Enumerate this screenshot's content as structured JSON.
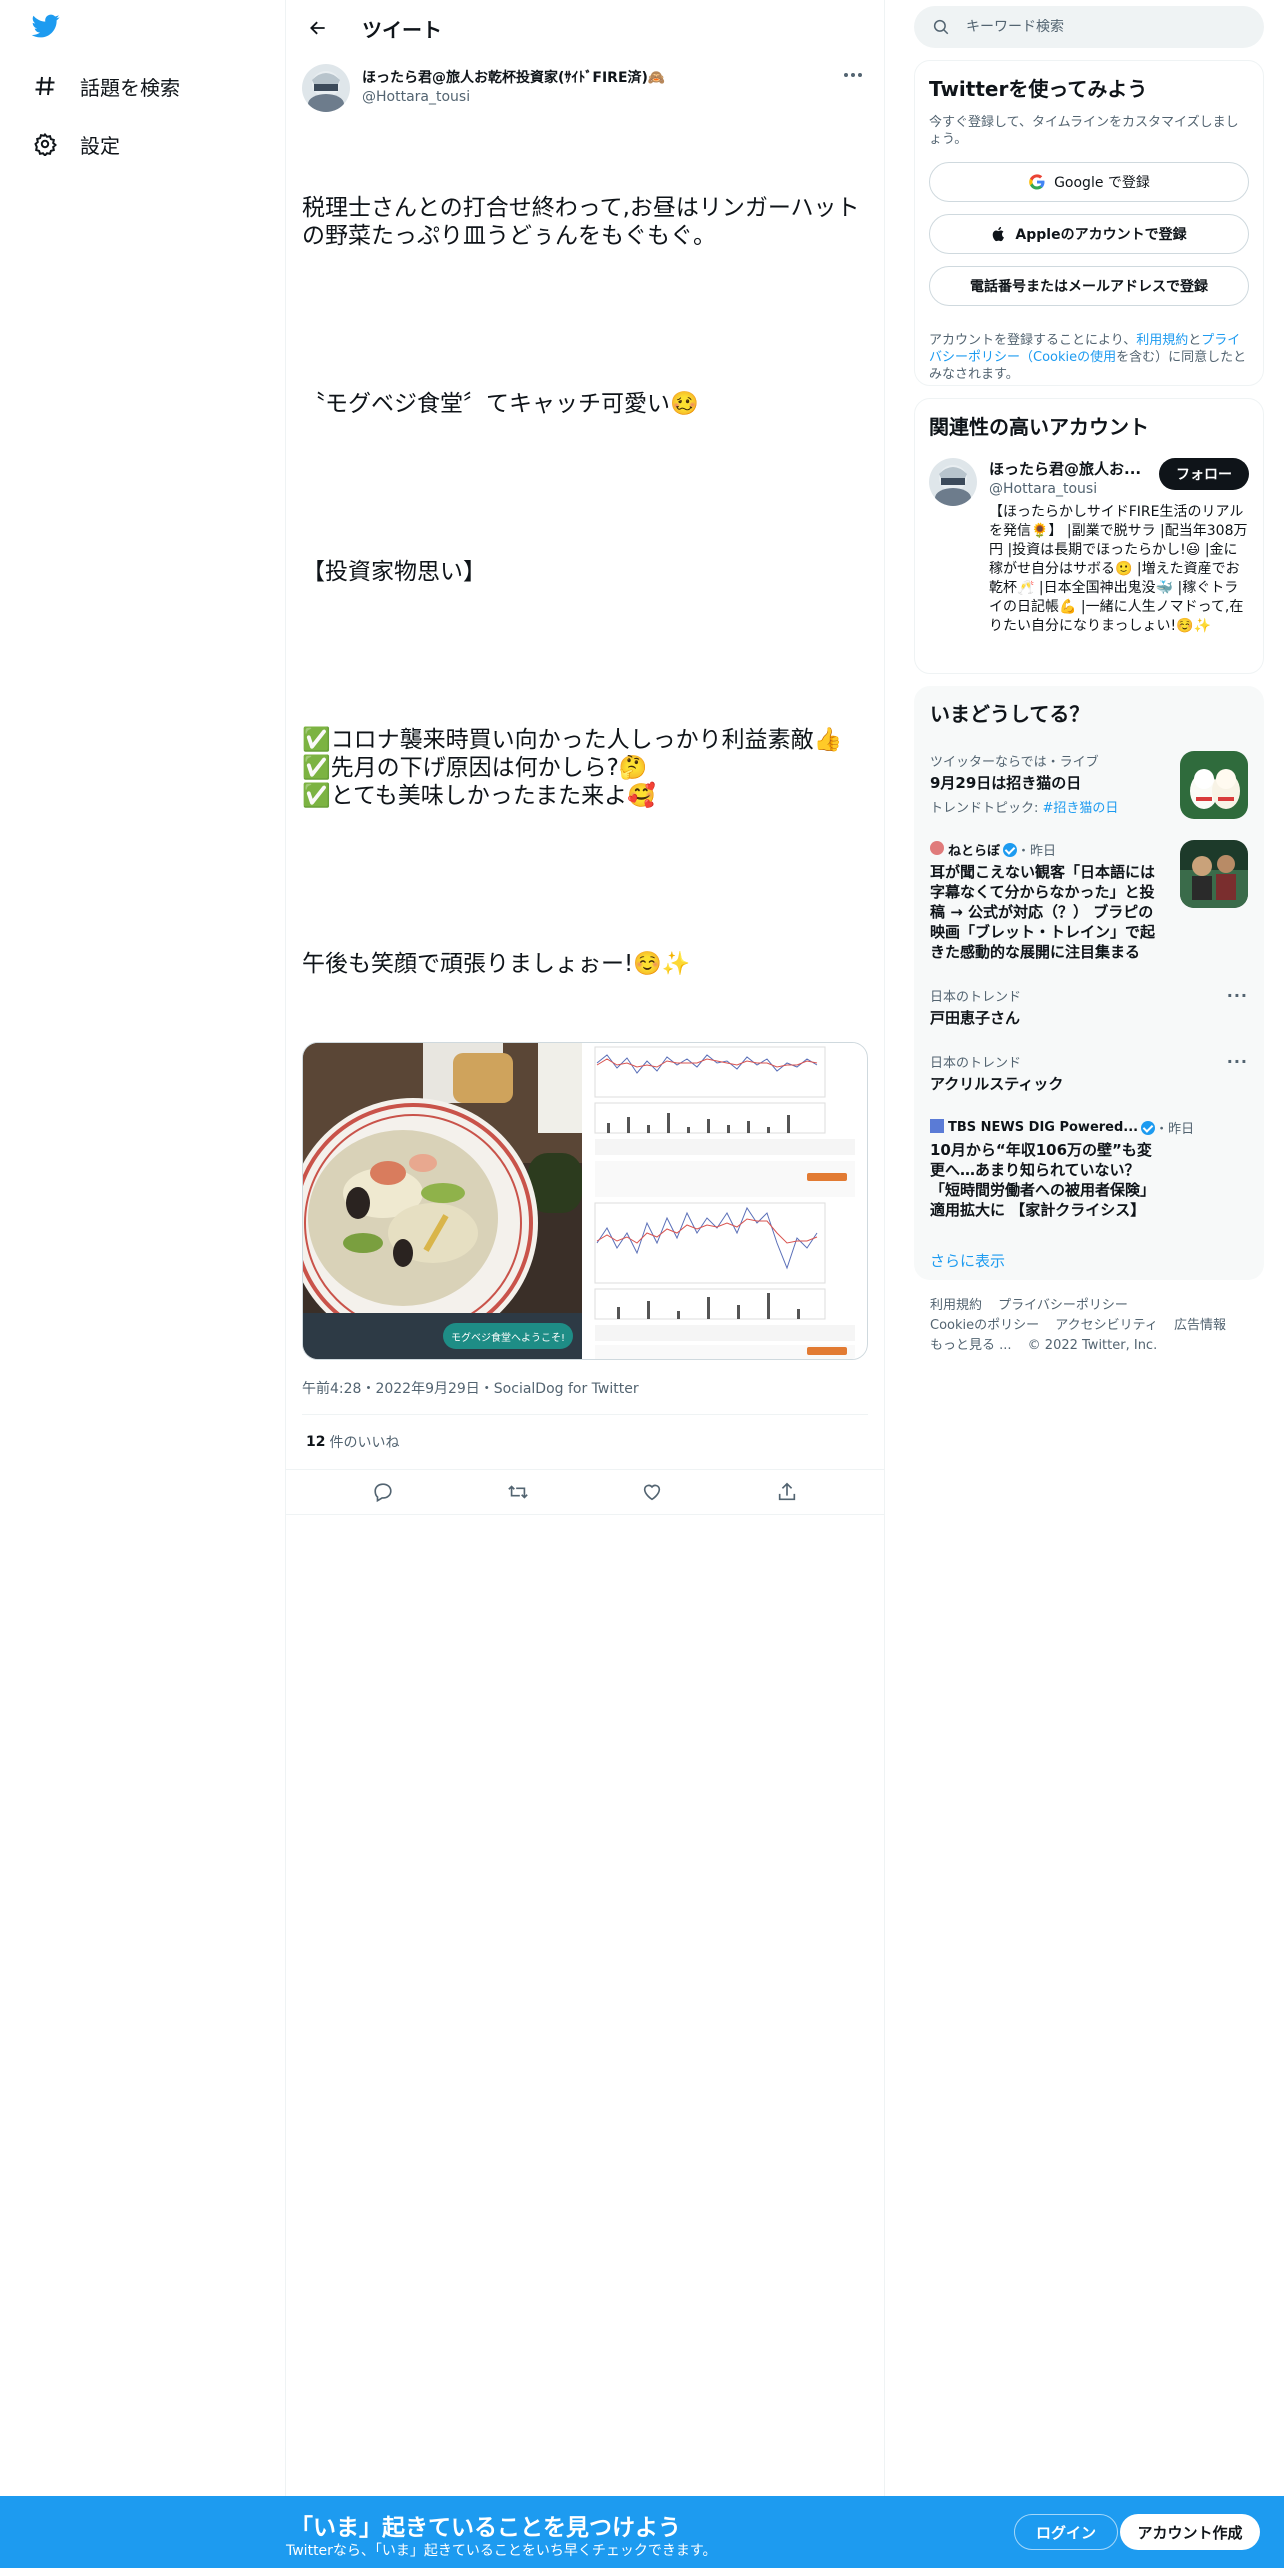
{
  "nav": {
    "explore_label": "話題を検索",
    "settings_label": "設定"
  },
  "header": {
    "title": "ツイート"
  },
  "tweet": {
    "author_name": "ほったら君@旅人お乾杯投資家(ｻｲﾄﾞFIRE済)🙈",
    "author_handle": "@Hottara_tousi",
    "paragraphs": [
      "税理士さんとの打合せ終わって,お昼はリンガーハットの野菜たっぷり皿うどぅんをもぐもぐ。",
      "〝モグベジ食堂〞てキャッチ可愛い🥴",
      "【投資家物思い】",
      "✅コロナ襲来時買い向かった人しっかり利益素敵👍\n✅先月の下げ原因は何かしら?🤔\n✅とても美味しかったまた来よ🥰",
      "午後も笑顔で頑張りましょぉー!☺️✨"
    ],
    "meta": "午前4:28・2022年9月29日・SocialDog for Twitter",
    "likes_count": "12",
    "likes_label": "件のいいね",
    "image_caption": "モグベジ食堂へようこそ!"
  },
  "search": {
    "placeholder": "キーワード検索"
  },
  "signup_card": {
    "title": "Twitterを使ってみよう",
    "subtitle": "今すぐ登録して、タイムラインをカスタマイズしましょう。",
    "google_label": "Google で登録",
    "apple_label": "Appleのアカウントで登録",
    "phone_label": "電話番号またはメールアドレスで登録",
    "legal_prefix": "アカウントを登録することにより、",
    "legal_terms": "利用規約",
    "legal_and": "と",
    "legal_privacy": "プライバシーポリシー（Cookieの使用",
    "legal_suffix": "を含む）に同意したとみなされます。"
  },
  "related": {
    "title": "関連性の高いアカウント",
    "name": "ほったら君@旅人お...",
    "handle": "@Hottara_tousi",
    "follow_label": "フォロー",
    "bio": "【ほったらかしサイドFIRE生活のリアルを発信🌻】 |副業で脱サラ |配当年308万円 |投資は長期でほったらかし!😃 |金に稼がせ自分はサボる🙂 |増えた資産でお乾杯🥂 |日本全国神出鬼没🐳 |稼ぐトライの日記帳💪 |一緒に人生ノマドって,在りたい自分になりまっしょい!☺️✨"
  },
  "trends": {
    "title": "いまどうしてる？",
    "items": [
      {
        "context": "ツイッターならでは・ライブ",
        "title": "9月29日は招き猫の日",
        "sub_prefix": "トレンドトピック: ",
        "sub_link": "#招き猫の日"
      },
      {
        "source": "ねとらぼ",
        "time": "・昨日",
        "title": "耳が聞こえない観客「日本語には字幕なくて分からなかった」と投稿 → 公式が対応（？） ブラピの映画「ブレット・トレイン」で起きた感動的な展開に注目集まる"
      },
      {
        "context": "日本のトレンド",
        "title": "戸田恵子さん"
      },
      {
        "context": "日本のトレンド",
        "title": "アクリルスティック"
      },
      {
        "source": "TBS NEWS DIG Powered...",
        "time": "・昨日",
        "title": "10月から“年収106万の壁”も変更へ…あまり知られていない？「短時間労働者への被用者保険」適用拡大に 【家計クライシス】"
      }
    ],
    "show_more": "さらに表示"
  },
  "footer": {
    "terms": "利用規約",
    "privacy": "プライバシーポリシー",
    "cookie": "Cookieのポリシー",
    "accessibility": "アクセシビリティ",
    "ads": "広告情報",
    "more": "もっと見る ...",
    "copyright": "© 2022 Twitter, Inc."
  },
  "bottom_bar": {
    "title": "「いま」起きていることを見つけよう",
    "subtitle": "Twitterなら、「いま」起きていることをいち早くチェックできます。",
    "login_label": "ログイン",
    "signup_label": "アカウント作成"
  },
  "colors": {
    "brand": "#1d9bf0",
    "text": "#0f1419",
    "secondary": "#536471"
  }
}
